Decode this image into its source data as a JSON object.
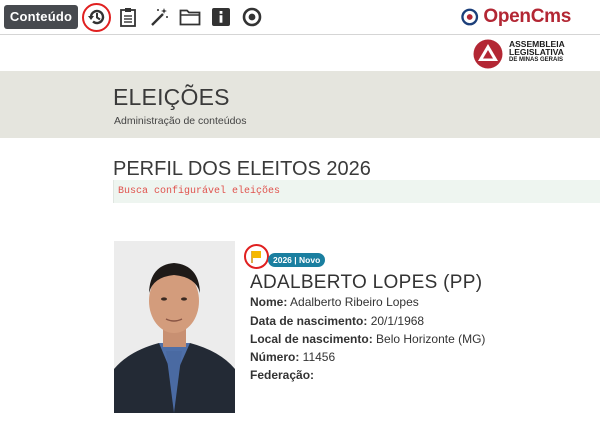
{
  "toolbar": {
    "content_button": "Conteúdo",
    "icons": [
      "history-icon",
      "clipboard-icon",
      "magic-wand-icon",
      "folder-icon",
      "info-icon",
      "target-icon"
    ]
  },
  "logos": {
    "opencms": "OpenCms",
    "almg_line1": "ASSEMBLEIA",
    "almg_line2": "LEGISLATIVA",
    "almg_line3": "DE MINAS GERAIS"
  },
  "header": {
    "title": "ELEIÇÕES",
    "subtitle": "Administração de conteúdos"
  },
  "section": {
    "title": "PERFIL DOS ELEITOS 2026",
    "search_label": "Busca configurável eleições"
  },
  "profile": {
    "badge": "2026 | Novo",
    "name": "ADALBERTO LOPES (PP)",
    "fields": [
      {
        "label": "Nome:",
        "value": " Adalberto Ribeiro Lopes"
      },
      {
        "label": "Data de nascimento:",
        "value": " 20/1/1968"
      },
      {
        "label": "Local de nascimento:",
        "value": " Belo Horizonte (MG)"
      },
      {
        "label": "Número:",
        "value": " 11456"
      },
      {
        "label": "Federação:",
        "value": ""
      }
    ]
  },
  "colors": {
    "toolbar_button": "#474a4f",
    "highlight_ring": "#e02020",
    "badge": "#1a7fa0",
    "band": "#e5e5de",
    "search_text": "#e0534e",
    "flag": "#f5b800"
  }
}
